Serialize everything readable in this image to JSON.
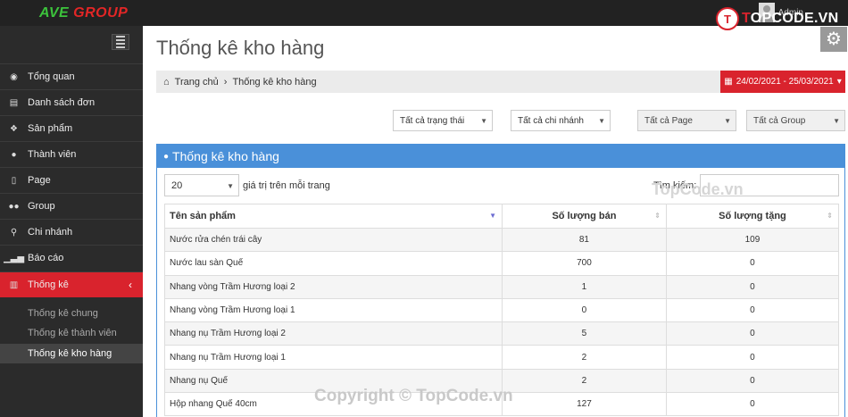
{
  "header": {
    "logo_primary": "AVE",
    "logo_secondary": "GROUP",
    "user_name": "Admin",
    "brand_mark": "T",
    "brand_t": "T",
    "brand_rest": "OPCODE.VN"
  },
  "sidebar": {
    "items": [
      {
        "label": "Tổng quan",
        "icon": "dashboard-icon"
      },
      {
        "label": "Danh sách đơn",
        "icon": "list-icon"
      },
      {
        "label": "Sản phẩm",
        "icon": "dropbox-icon"
      },
      {
        "label": "Thành viên",
        "icon": "user-icon"
      },
      {
        "label": "Page",
        "icon": "page-icon"
      },
      {
        "label": "Group",
        "icon": "users-icon"
      },
      {
        "label": "Chi nhánh",
        "icon": "map-marker-icon"
      },
      {
        "label": "Báo cáo",
        "icon": "signal-icon"
      },
      {
        "label": "Thống kê",
        "icon": "bar-chart-icon",
        "active": true
      }
    ],
    "sub_items": [
      {
        "label": "Thống kê chung"
      },
      {
        "label": "Thống kê thành viên"
      },
      {
        "label": "Thống kê kho hàng",
        "active": true
      }
    ]
  },
  "page": {
    "title": "Thống kê kho hàng"
  },
  "breadcrumb": {
    "home": "Trang chủ",
    "separator": "›",
    "current": "Thống kê kho hàng"
  },
  "date_range": "24/02/2021 - 25/03/2021",
  "filters": {
    "status": "Tất cả trạng thái",
    "branch": "Tất cả chi nhánh",
    "page": "Tất cả Page",
    "group": "Tất cả Group"
  },
  "panel": {
    "title": "Thống kê kho hàng",
    "page_length": "20",
    "page_length_label": "giá trị trên mỗi trang",
    "search_label": "Tìm kiếm:"
  },
  "table": {
    "columns": [
      "Tên sản phẩm",
      "Số lượng bán",
      "Số lượng tặng"
    ],
    "rows": [
      [
        "Nước rửa chén trái cây",
        "81",
        "109"
      ],
      [
        "Nước lau sàn Quế",
        "700",
        "0"
      ],
      [
        "Nhang vòng Trầm Hương loại 2",
        "1",
        "0"
      ],
      [
        "Nhang vòng Trầm Hương loại 1",
        "0",
        "0"
      ],
      [
        "Nhang nụ Trầm Hương loại 2",
        "5",
        "0"
      ],
      [
        "Nhang nụ Trầm Hương loại 1",
        "2",
        "0"
      ],
      [
        "Nhang nụ Quế",
        "2",
        "0"
      ],
      [
        "Hộp nhang Quế 40cm",
        "127",
        "0"
      ]
    ]
  },
  "watermarks": {
    "top": "TopCode.vn",
    "bottom": "Copyright © TopCode.vn"
  },
  "colors": {
    "accent_red": "#d9232d",
    "panel_blue": "#4a90d9",
    "sidebar_bg": "#2b2b2b"
  }
}
